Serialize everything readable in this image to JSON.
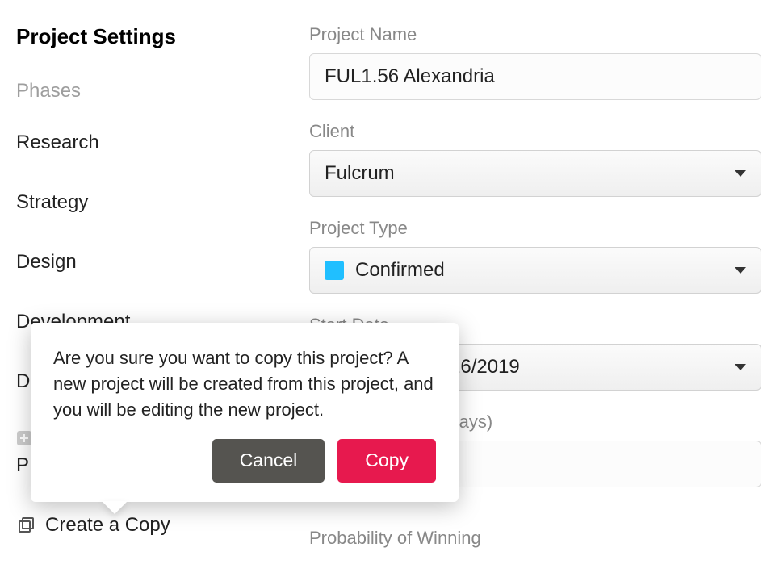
{
  "sidebar": {
    "title": "Project Settings",
    "section_label": "Phases",
    "items": [
      "Research",
      "Strategy",
      "Design",
      "Development"
    ],
    "letter_d": "D",
    "letter_p": "P",
    "create_copy_label": "Create a Copy"
  },
  "form": {
    "project_name_label": "Project Name",
    "project_name_value": "FUL1.56 Alexandria",
    "client_label": "Client",
    "client_value": "Fulcrum",
    "project_type_label": "Project Type",
    "project_type_value": "Confirmed",
    "start_date_label": "Start Date",
    "start_date_value": "26/2019",
    "duration_label_fragment": "g days)",
    "probability_label": "Probability of Winning"
  },
  "popover": {
    "message": "Are you sure you want to copy this project? A new project will be created from this project, and you will be editing the new project.",
    "cancel_label": "Cancel",
    "copy_label": "Copy"
  },
  "colors": {
    "accent": "#e7194e",
    "chip": "#20bfff"
  }
}
